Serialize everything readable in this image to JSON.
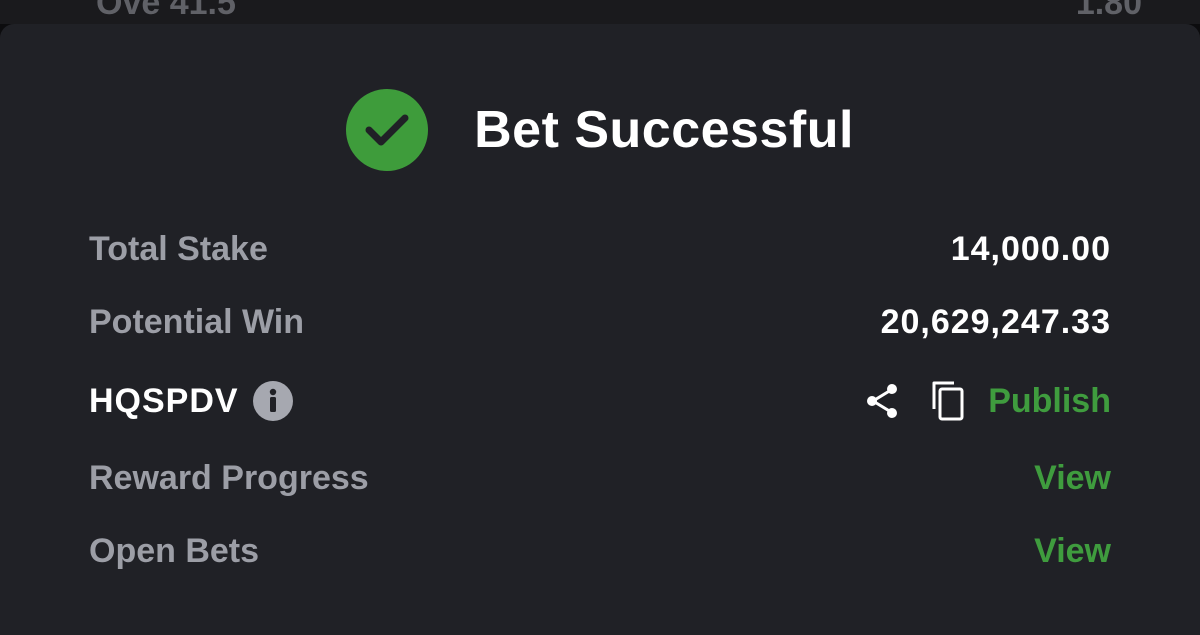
{
  "status_bar_ghost": {
    "left_text": "Ove 41.5",
    "right_text": "1.80"
  },
  "header": {
    "title": "Bet Successful",
    "status_icon": "check-circle-icon"
  },
  "summary": {
    "total_stake_label": "Total Stake",
    "total_stake_value": "14,000.00",
    "potential_win_label": "Potential Win",
    "potential_win_value": "20,629,247.33"
  },
  "booking": {
    "code": "HQSPDV",
    "info_icon": "info-icon",
    "share_icon": "share-icon",
    "copy_icon": "copy-icon",
    "publish_label": "Publish"
  },
  "links": {
    "reward_progress_label": "Reward Progress",
    "reward_progress_action": "View",
    "open_bets_label": "Open Bets",
    "open_bets_action": "View"
  },
  "colors": {
    "background": "#202126",
    "accent_green": "#3f9c3e",
    "label_gray": "#9c9ea6",
    "text_white": "#ffffff"
  }
}
